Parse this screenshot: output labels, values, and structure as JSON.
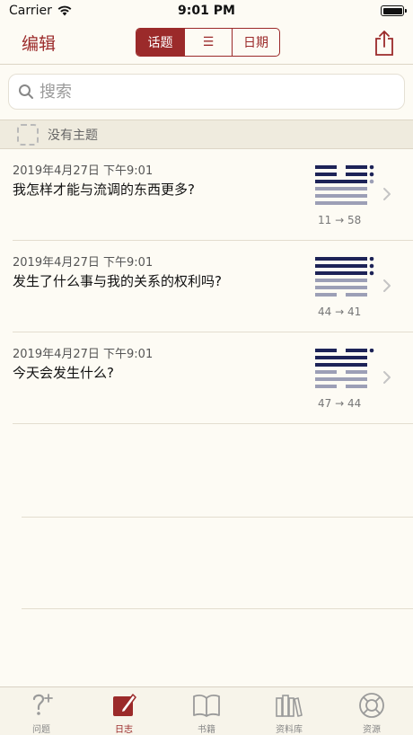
{
  "status": {
    "carrier": "Carrier",
    "time": "9:01 PM"
  },
  "nav": {
    "edit_label": "编辑",
    "segments": [
      {
        "label": "话题",
        "active": true
      },
      {
        "label": "☰",
        "active": false
      },
      {
        "label": "日期",
        "active": false
      }
    ]
  },
  "search": {
    "placeholder": "搜索"
  },
  "section": {
    "title": "没有主题"
  },
  "entries": [
    {
      "date": "2019年4月27日 下午9:01",
      "question": "我怎样才能与流调的东西更多?",
      "from": "11",
      "arrow": "→",
      "to": "58"
    },
    {
      "date": "2019年4月27日 下午9:01",
      "question": "发生了什么事与我的关系的权利吗?",
      "from": "44",
      "arrow": "→",
      "to": "41"
    },
    {
      "date": "2019年4月27日 下午9:01",
      "question": "今天会发生什么?",
      "from": "47",
      "arrow": "→",
      "to": "44"
    }
  ],
  "tabs": [
    {
      "label": "问题",
      "icon": "question-icon",
      "active": false
    },
    {
      "label": "日志",
      "icon": "journal-icon",
      "active": true
    },
    {
      "label": "书籍",
      "icon": "book-icon",
      "active": false
    },
    {
      "label": "资料库",
      "icon": "library-icon",
      "active": false
    },
    {
      "label": "资源",
      "icon": "lifebuoy-icon",
      "active": false
    }
  ],
  "colors": {
    "accent": "#9b2a2a",
    "hexagram_primary": "#1d2357",
    "hexagram_secondary": "#9c9fb6"
  }
}
